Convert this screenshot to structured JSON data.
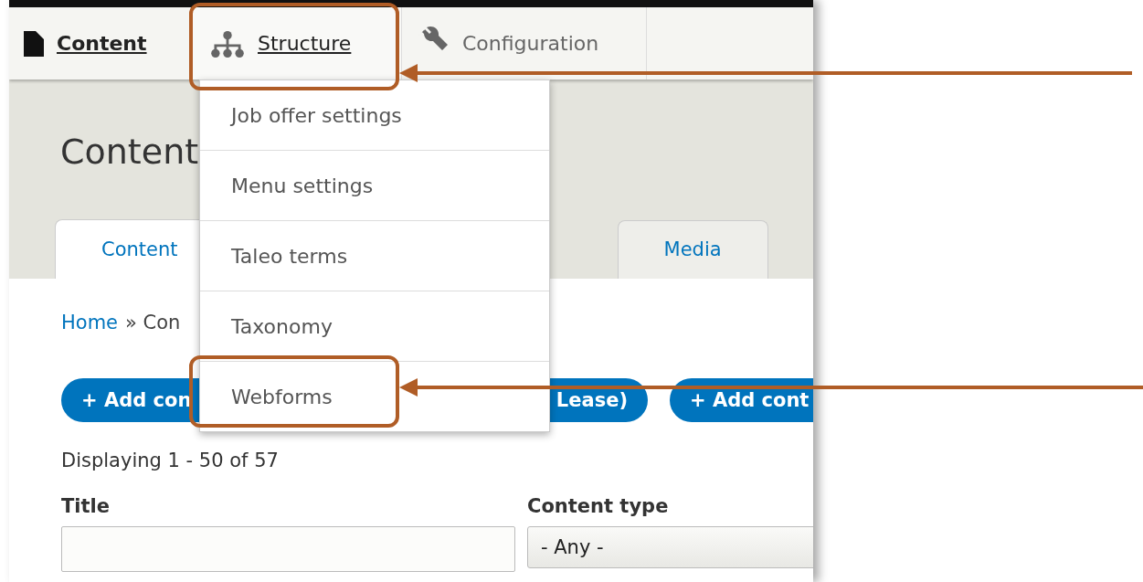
{
  "toolbar": {
    "items": [
      {
        "label": "Content"
      },
      {
        "label": "Structure"
      },
      {
        "label": "Configuration"
      }
    ]
  },
  "page_title": "Content",
  "tabs": [
    {
      "label": "Content",
      "selected": true
    },
    {
      "label": "Media",
      "selected": false
    }
  ],
  "breadcrumb": {
    "link": "Home",
    "rest": "» Con"
  },
  "action_buttons": [
    "+ Add con",
    "Lease)",
    "+ Add cont"
  ],
  "summary": "Displaying 1 - 50 of 57",
  "filters": [
    {
      "label": "Title",
      "kind": "text"
    },
    {
      "label": "Content type",
      "kind": "select",
      "value": "- Any -"
    }
  ],
  "dropdown_menu": {
    "items": [
      {
        "label": "Job offer settings"
      },
      {
        "label": "Menu settings"
      },
      {
        "label": "Taleo terms"
      },
      {
        "label": "Taxonomy"
      },
      {
        "label": "Webforms"
      }
    ]
  }
}
